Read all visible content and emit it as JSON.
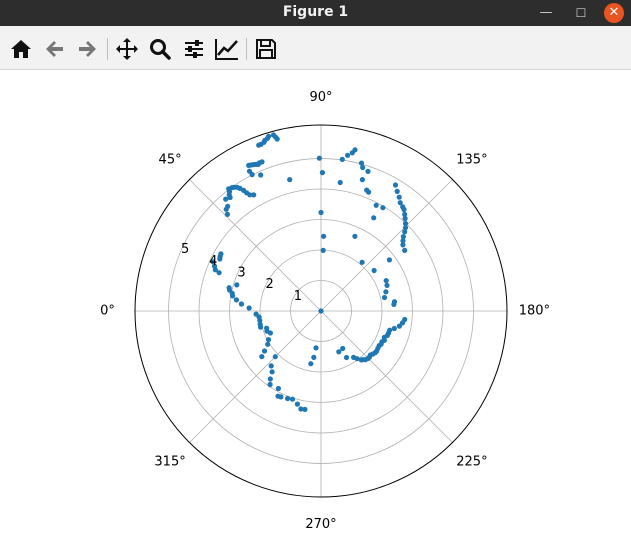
{
  "window": {
    "title": "Figure 1",
    "controls": {
      "minimize": "—",
      "maximize": "☐",
      "close": "✕"
    }
  },
  "toolbar": {
    "buttons": [
      {
        "name": "home",
        "icon": "home-icon"
      },
      {
        "name": "back",
        "icon": "arrow-left-icon"
      },
      {
        "name": "forward",
        "icon": "arrow-right-icon"
      },
      {
        "name": "pan",
        "icon": "move-icon"
      },
      {
        "name": "zoom",
        "icon": "magnifier-icon"
      },
      {
        "name": "configure-subplots",
        "icon": "sliders-icon"
      },
      {
        "name": "edit-axis",
        "icon": "line-chart-icon"
      },
      {
        "name": "save",
        "icon": "floppy-disk-icon"
      }
    ]
  },
  "colors": {
    "point": "#1f77b4",
    "grid": "#b0b0b0",
    "spine": "#000000",
    "titlebar": "#2d2d2d",
    "close": "#e95420"
  },
  "chart_data": {
    "type": "scatter",
    "projection": "polar",
    "theta_direction": "clockwise",
    "theta_zero": "left",
    "rlim": [
      0,
      6.1
    ],
    "grid": true,
    "angle_ticks": [
      "0°",
      "45°",
      "90°",
      "135°",
      "180°",
      "225°",
      "270°",
      "315°"
    ],
    "angle_tick_values": [
      0,
      45,
      90,
      135,
      180,
      225,
      270,
      315
    ],
    "r_ticks": [
      "1",
      "2",
      "3",
      "4",
      "5"
    ],
    "r_tick_values": [
      1,
      2,
      3,
      4,
      5
    ],
    "r_label_angle": 22.5,
    "series": [
      {
        "points": [
          {
            "theta": 69.4,
            "r": 5.81
          },
          {
            "theta": 70.2,
            "r": 5.81
          },
          {
            "theta": 71.3,
            "r": 5.84
          },
          {
            "theta": 71.8,
            "r": 5.89
          },
          {
            "theta": 72.8,
            "r": 5.93
          },
          {
            "theta": 73.3,
            "r": 5.98
          },
          {
            "theta": 74.9,
            "r": 5.98
          },
          {
            "theta": 75.4,
            "r": 5.89
          },
          {
            "theta": 75.7,
            "r": 5.82
          },
          {
            "theta": 63.6,
            "r": 5.33
          },
          {
            "theta": 64.4,
            "r": 5.31
          },
          {
            "theta": 65.2,
            "r": 5.29
          },
          {
            "theta": 66.1,
            "r": 5.26
          },
          {
            "theta": 66.8,
            "r": 5.23
          },
          {
            "theta": 67.4,
            "r": 5.26
          },
          {
            "theta": 68.4,
            "r": 5.26
          },
          {
            "theta": 62.9,
            "r": 5.15
          },
          {
            "theta": 63.2,
            "r": 5.01
          },
          {
            "theta": 66.1,
            "r": 4.88
          },
          {
            "theta": 59.9,
            "r": 4.4
          },
          {
            "theta": 58.5,
            "r": 4.47
          },
          {
            "theta": 57.8,
            "r": 4.58
          },
          {
            "theta": 57.3,
            "r": 4.7
          },
          {
            "theta": 56.5,
            "r": 4.82
          },
          {
            "theta": 55.9,
            "r": 4.9
          },
          {
            "theta": 54.9,
            "r": 4.96
          },
          {
            "theta": 54.2,
            "r": 4.99
          },
          {
            "theta": 52.9,
            "r": 5.02
          },
          {
            "theta": 52.5,
            "r": 4.93
          },
          {
            "theta": 51.7,
            "r": 4.86
          },
          {
            "theta": 51.3,
            "r": 4.77
          },
          {
            "theta": 49.6,
            "r": 4.82
          },
          {
            "theta": 48.3,
            "r": 4.6
          },
          {
            "theta": 47.0,
            "r": 4.56
          },
          {
            "theta": 45.9,
            "r": 4.41
          },
          {
            "theta": 76.6,
            "r": 4.43
          },
          {
            "theta": 29.7,
            "r": 3.78
          },
          {
            "theta": 28.3,
            "r": 3.76
          },
          {
            "theta": 27.2,
            "r": 3.73
          },
          {
            "theta": 24.5,
            "r": 3.89
          },
          {
            "theta": 22.8,
            "r": 3.79
          },
          {
            "theta": 21.3,
            "r": 3.72
          },
          {
            "theta": 20.6,
            "r": 3.57
          },
          {
            "theta": 17.2,
            "r": 2.89
          },
          {
            "theta": 14.2,
            "r": 3.11
          },
          {
            "theta": 12.9,
            "r": 3.08
          },
          {
            "theta": 11.2,
            "r": 2.97
          },
          {
            "theta": 9.7,
            "r": 2.94
          },
          {
            "theta": 7.5,
            "r": 2.8
          },
          {
            "theta": 5.0,
            "r": 2.62
          },
          {
            "theta": 2.4,
            "r": 2.36
          },
          {
            "theta": -2.7,
            "r": 2.13
          },
          {
            "theta": -5.6,
            "r": 2.04
          },
          {
            "theta": -8.8,
            "r": 2.03
          },
          {
            "theta": -12.4,
            "r": 2.04
          },
          {
            "theta": -14.9,
            "r": 2.05
          },
          {
            "theta": -17.6,
            "r": 1.87
          },
          {
            "theta": -20.4,
            "r": 1.89
          },
          {
            "theta": -23.5,
            "r": 1.81
          },
          {
            "theta": -28.6,
            "r": 1.96
          },
          {
            "theta": -32.0,
            "r": 2.06
          },
          {
            "theta": -35.3,
            "r": 2.27
          },
          {
            "theta": -37.6,
            "r": 2.45
          },
          {
            "theta": -45.0,
            "r": 2.12
          },
          {
            "theta": -47.8,
            "r": 2.43
          },
          {
            "theta": -51.2,
            "r": 2.56
          },
          {
            "theta": -53.3,
            "r": 2.78
          },
          {
            "theta": -55.3,
            "r": 2.93
          },
          {
            "theta": -61.2,
            "r": 2.9
          },
          {
            "theta": -63.2,
            "r": 3.13
          },
          {
            "theta": -65.0,
            "r": 3.11
          },
          {
            "theta": -69.1,
            "r": 3.07
          },
          {
            "theta": -72.1,
            "r": 3.04
          },
          {
            "theta": -75.8,
            "r": 3.15
          },
          {
            "theta": -78.4,
            "r": 3.28
          },
          {
            "theta": -80.7,
            "r": 3.27
          },
          {
            "theta": -82.3,
            "r": 1.22
          },
          {
            "theta": -81.2,
            "r": 1.54
          },
          {
            "theta": -79.0,
            "r": 1.76
          },
          {
            "theta": -120.1,
            "r": 1.42
          },
          {
            "theta": -113.6,
            "r": 1.46
          },
          {
            "theta": -118.7,
            "r": 1.74
          },
          {
            "theta": -125.1,
            "r": 1.86
          },
          {
            "theta": -127.1,
            "r": 1.96
          },
          {
            "theta": -129.5,
            "r": 2.08
          },
          {
            "theta": -130.8,
            "r": 2.11
          },
          {
            "theta": -132.5,
            "r": 2.16
          },
          {
            "theta": -134.6,
            "r": 2.19
          },
          {
            "theta": -136.4,
            "r": 2.19
          },
          {
            "theta": -138.3,
            "r": 2.17
          },
          {
            "theta": -140.4,
            "r": 2.21
          },
          {
            "theta": -142.5,
            "r": 2.24
          },
          {
            "theta": -144.3,
            "r": 2.25
          },
          {
            "theta": -146.8,
            "r": 2.23
          },
          {
            "theta": -149.3,
            "r": 2.22
          },
          {
            "theta": -151.1,
            "r": 2.25
          },
          {
            "theta": -153.3,
            "r": 2.24
          },
          {
            "theta": -155.2,
            "r": 2.29
          },
          {
            "theta": -157.4,
            "r": 2.25
          },
          {
            "theta": -159.8,
            "r": 2.32
          },
          {
            "theta": -161.9,
            "r": 2.33
          },
          {
            "theta": -164.4,
            "r": 2.34
          },
          {
            "theta": -166.6,
            "r": 2.47
          },
          {
            "theta": -169.1,
            "r": 2.62
          },
          {
            "theta": -171.7,
            "r": 2.7
          },
          {
            "theta": -174.2,
            "r": 2.76
          },
          {
            "theta": 174.8,
            "r": 2.4
          },
          {
            "theta": 172.8,
            "r": 2.43
          },
          {
            "theta": 168.0,
            "r": 2.13
          },
          {
            "theta": 163.5,
            "r": 2.22
          },
          {
            "theta": 158.8,
            "r": 2.32
          },
          {
            "theta": 155.0,
            "r": 2.36
          },
          {
            "theta": 142.7,
            "r": 2.19
          },
          {
            "theta": 130.2,
            "r": 2.09
          },
          {
            "theta": 144.1,
            "r": 3.39
          },
          {
            "theta": 141.1,
            "r": 3.45
          },
          {
            "theta": 139.4,
            "r": 3.54
          },
          {
            "theta": 137.9,
            "r": 3.64
          },
          {
            "theta": 136.6,
            "r": 3.78
          },
          {
            "theta": 135.4,
            "r": 3.89
          },
          {
            "theta": 134.0,
            "r": 3.99
          },
          {
            "theta": 132.3,
            "r": 4.1
          },
          {
            "theta": 130.9,
            "r": 4.19
          },
          {
            "theta": 129.3,
            "r": 4.3
          },
          {
            "theta": 128.1,
            "r": 4.34
          },
          {
            "theta": 126.2,
            "r": 4.4
          },
          {
            "theta": 124.5,
            "r": 4.53
          },
          {
            "theta": 122.5,
            "r": 4.65
          },
          {
            "theta": 120.6,
            "r": 4.8
          },
          {
            "theta": 143.2,
            "r": 2.8
          },
          {
            "theta": 119.5,
            "r": 3.51
          },
          {
            "theta": 120.9,
            "r": 3.95
          },
          {
            "theta": 117.6,
            "r": 3.91
          },
          {
            "theta": 114.4,
            "r": 2.69
          },
          {
            "theta": 107.5,
            "r": 4.52
          },
          {
            "theta": 108.6,
            "r": 4.83
          },
          {
            "theta": 106.2,
            "r": 4.9
          },
          {
            "theta": 105.3,
            "r": 5.03
          },
          {
            "theta": 101.9,
            "r": 5.4
          },
          {
            "theta": 101.2,
            "r": 5.29
          },
          {
            "theta": 99.7,
            "r": 5.18
          },
          {
            "theta": 98.0,
            "r": 5.02
          },
          {
            "theta": 98.5,
            "r": 4.26
          },
          {
            "theta": 89.4,
            "r": 5.01
          },
          {
            "theta": 90.6,
            "r": 4.54
          },
          {
            "theta": 90.0,
            "r": 3.23
          },
          {
            "theta": 92.0,
            "r": 2.45
          },
          {
            "theta": 92.1,
            "r": 1.99
          },
          {
            "theta": 110.7,
            "r": 4.24
          },
          {
            "theta": 111.8,
            "r": 4.2
          },
          {
            "theta": 0.0,
            "r": 0.0
          }
        ]
      }
    ]
  }
}
